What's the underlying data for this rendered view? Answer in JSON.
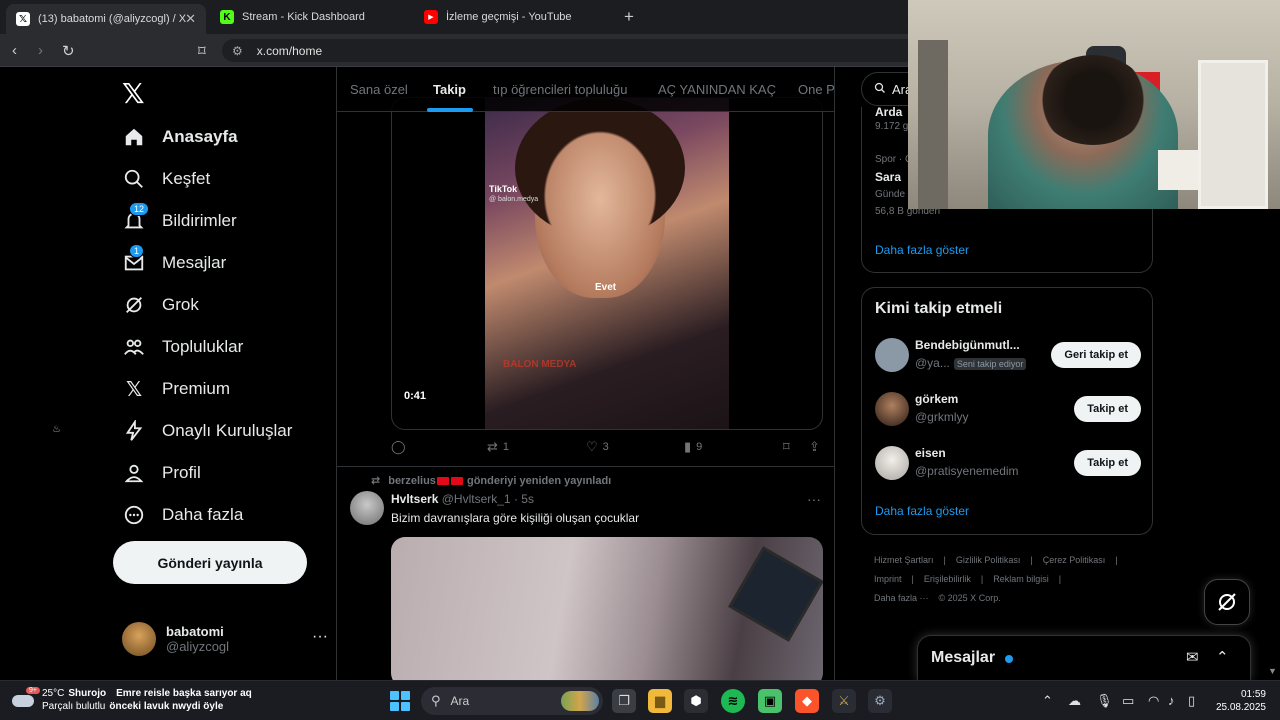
{
  "browser": {
    "tabs": [
      {
        "title": "(13) babatomi (@aliyzcogl) / X",
        "active": true
      },
      {
        "title": "Stream - Kick Dashboard",
        "active": false
      },
      {
        "title": "İzleme geçmişi - YouTube",
        "active": false
      }
    ],
    "url": "x.com/home"
  },
  "nav": {
    "items": [
      {
        "label": "Anasayfa",
        "icon": "home-icon"
      },
      {
        "label": "Keşfet",
        "icon": "search-icon"
      },
      {
        "label": "Bildirimler",
        "icon": "bell-icon",
        "badge": "12"
      },
      {
        "label": "Mesajlar",
        "icon": "mail-icon",
        "badge": "1"
      },
      {
        "label": "Grok",
        "icon": "grok-icon"
      },
      {
        "label": "Topluluklar",
        "icon": "communities-icon"
      },
      {
        "label": "Premium",
        "icon": "x-premium-icon"
      },
      {
        "label": "Onaylı Kuruluşlar",
        "icon": "lightning-icon"
      },
      {
        "label": "Profil",
        "icon": "person-icon"
      },
      {
        "label": "Daha fazla",
        "icon": "more-circle-icon"
      }
    ],
    "post_button": "Gönderi yayınla",
    "account": {
      "name": "babatomi",
      "handle": "@aliyzcogl"
    }
  },
  "feed": {
    "tabs": [
      "Sana özel",
      "Takip",
      "tıp öğrencileri topluluğu",
      "AÇ YANINDAN KAÇ",
      "One Pi"
    ],
    "active_tab": "Takip",
    "tweet1": {
      "video_duration": "0:41",
      "overlay_tiktok": "TikTok",
      "overlay_handle": "@ balon.medya",
      "overlay_caption": "Evet",
      "watermark": "BALON MEDYA",
      "retweets": "1",
      "likes": "3",
      "views": "9"
    },
    "tweet2": {
      "repost_by": "berzelius",
      "repost_suffix": "gönderiyi yeniden yayınladı",
      "name": "Hvltserk",
      "handle": "@Hvltserk_1",
      "time": "· 5s",
      "text": "Bizim davranışlara göre kişiliği oluşan çocuklar"
    }
  },
  "right": {
    "search_placeholder": "Ara",
    "trends": {
      "partial_title": "Arda",
      "partial_count": "9.172 g",
      "category": "Spor · C",
      "title": "Sara",
      "sub": "Günde",
      "count": "56,8 B gönderi",
      "show_more": "Daha fazla göster"
    },
    "who_to_follow": {
      "title": "Kimi takip etmeli",
      "users": [
        {
          "name": "Bendebigünmutl...",
          "handle": "@ya...",
          "follows_you": "Seni takip ediyor",
          "button": "Geri takip et"
        },
        {
          "name": "görkem",
          "handle": "@grkmlyy",
          "button": "Takip et"
        },
        {
          "name": "eisen",
          "handle": "@pratisyenemedim",
          "button": "Takip et"
        }
      ],
      "show_more": "Daha fazla göster"
    },
    "footer": [
      "Hizmet Şartları",
      "Gizlilik Politikası",
      "Çerez Politikası",
      "Imprint",
      "Erişilebilirlik",
      "Reklam bilgisi",
      "Daha fazla ···",
      "© 2025 X Corp."
    ],
    "messages_drawer": "Mesajlar"
  },
  "taskbar": {
    "weather_temp": "25°C",
    "weather_city": "Shurojo",
    "weather_desc": "Parçalı bulutlu",
    "weather_badge": "9+",
    "news_line1": "Emre reisle başka sarıyor aq",
    "news_line2": "önceki lavuk nwydi öyle",
    "search": "Ara",
    "time": "01:59",
    "date": "25.08.2025"
  },
  "colors": {
    "accent": "#1d9bf0",
    "background": "#000000",
    "text": "#e7e9ea",
    "muted": "#71767b"
  }
}
